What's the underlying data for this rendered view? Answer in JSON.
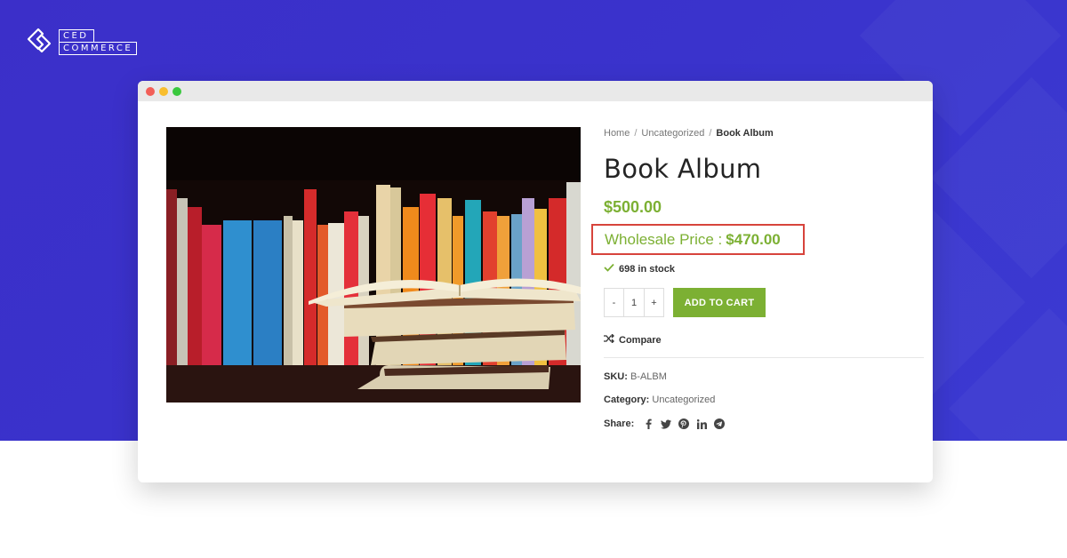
{
  "brand": {
    "logo_line1": "CED",
    "logo_line2": "COMMERCE"
  },
  "breadcrumb": {
    "items": [
      "Home",
      "Uncategorized"
    ],
    "separator": "/",
    "current": "Book Album"
  },
  "product": {
    "title": "Book Album",
    "price": "$500.00",
    "wholesale_label": "Wholesale Price :",
    "wholesale_value": "$470.00",
    "stock": "698 in stock",
    "quantity": "1",
    "qty_minus": "-",
    "qty_plus": "+",
    "add_to_cart": "ADD TO CART",
    "compare": "Compare",
    "sku_label": "SKU:",
    "sku_value": "B-ALBM",
    "category_label": "Category:",
    "category_value": "Uncategorized",
    "share_label": "Share:",
    "share_icons": [
      "facebook-icon",
      "twitter-icon",
      "pinterest-icon",
      "linkedin-icon",
      "telegram-icon"
    ]
  },
  "colors": {
    "background": "#3b2fc9",
    "accent_green": "#7cb033",
    "highlight_red": "#d7443c"
  }
}
